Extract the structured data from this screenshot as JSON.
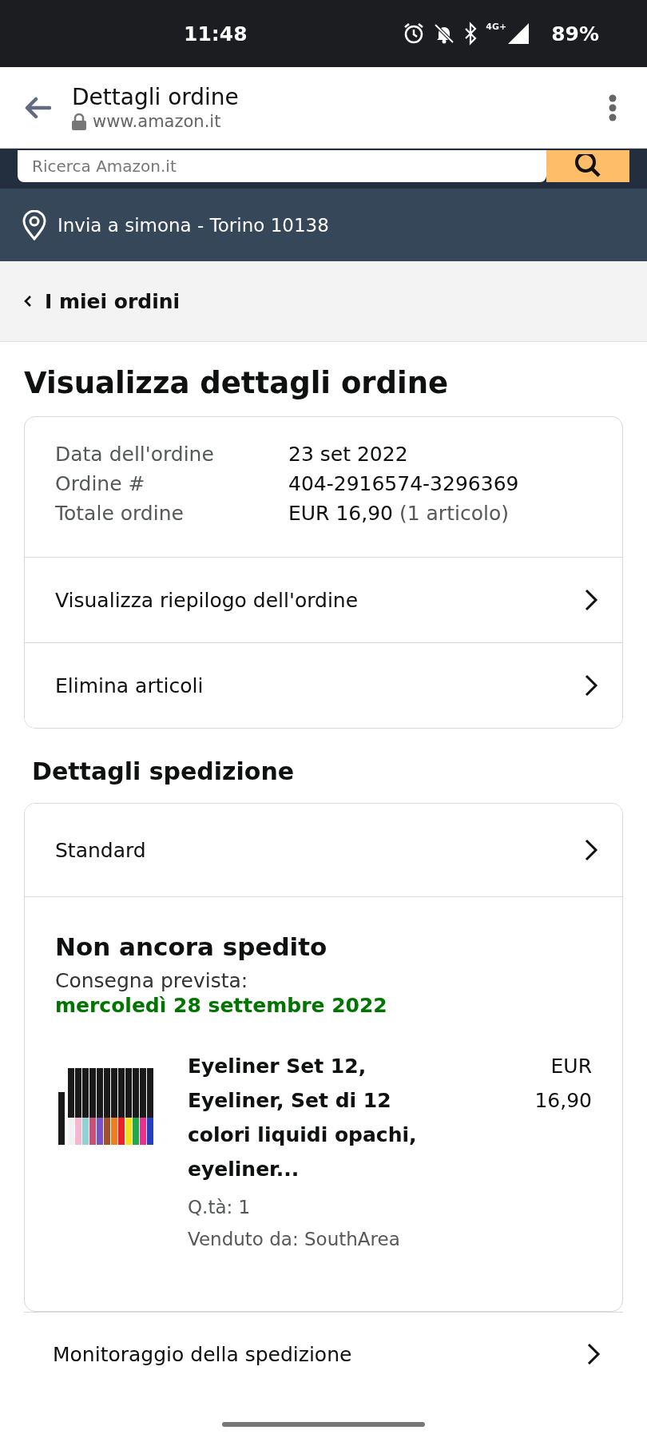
{
  "status_bar": {
    "time": "11:48",
    "network": "4G+",
    "battery": "89%"
  },
  "browser": {
    "title": "Dettagli ordine",
    "url": "www.amazon.it"
  },
  "search": {
    "placeholder": "Ricerca Amazon.it"
  },
  "location": {
    "text": "Invia a simona - Torino 10138"
  },
  "breadcrumb": {
    "label": "I miei ordini"
  },
  "page_title": "Visualizza dettagli ordine",
  "order": {
    "fields": [
      {
        "label": "Data dell'ordine",
        "value": "23 set 2022"
      },
      {
        "label": "Ordine #",
        "value": "404-2916574-3296369"
      },
      {
        "label": "Totale ordine",
        "value": "EUR 16,90",
        "note": "(1 articolo)"
      }
    ],
    "links": [
      "Visualizza riepilogo dell'ordine",
      "Elimina articoli"
    ]
  },
  "shipping": {
    "heading": "Dettagli spedizione",
    "method": "Standard",
    "status": "Non ancora spedito",
    "delivery_label": "Consegna prevista:",
    "delivery_date": "mercoledì 28 settembre 2022",
    "items": [
      {
        "title": "Eyeliner Set 12, Eyeliner, Set di 12 colori liquidi opachi, eyeliner...",
        "quantity": "Q.tà: 1",
        "seller": "Venduto da: SouthArea",
        "price": "EUR 16,90"
      }
    ]
  },
  "tracking": {
    "label": "Monitoraggio della spedizione"
  }
}
